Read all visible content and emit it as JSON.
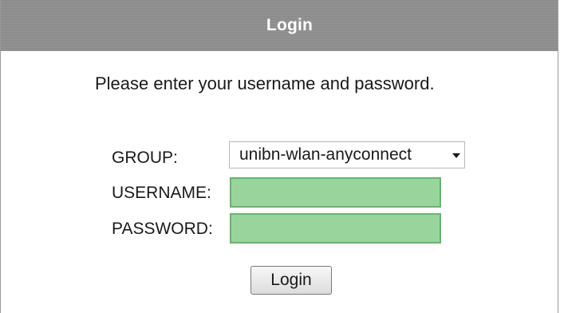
{
  "header": {
    "title": "Login"
  },
  "form": {
    "instructions": "Please enter your username and password.",
    "group_label": "GROUP:",
    "group_selected": "unibn-wlan-anyconnect",
    "username_label": "USERNAME:",
    "username_value": "",
    "password_label": "PASSWORD:",
    "password_value": "",
    "submit_label": "Login"
  },
  "colors": {
    "title_bar": "#8f8f8f",
    "input_fill": "#98d49c",
    "input_border": "#69b26e"
  },
  "icons": {
    "dropdown": "chevron-down-icon"
  }
}
